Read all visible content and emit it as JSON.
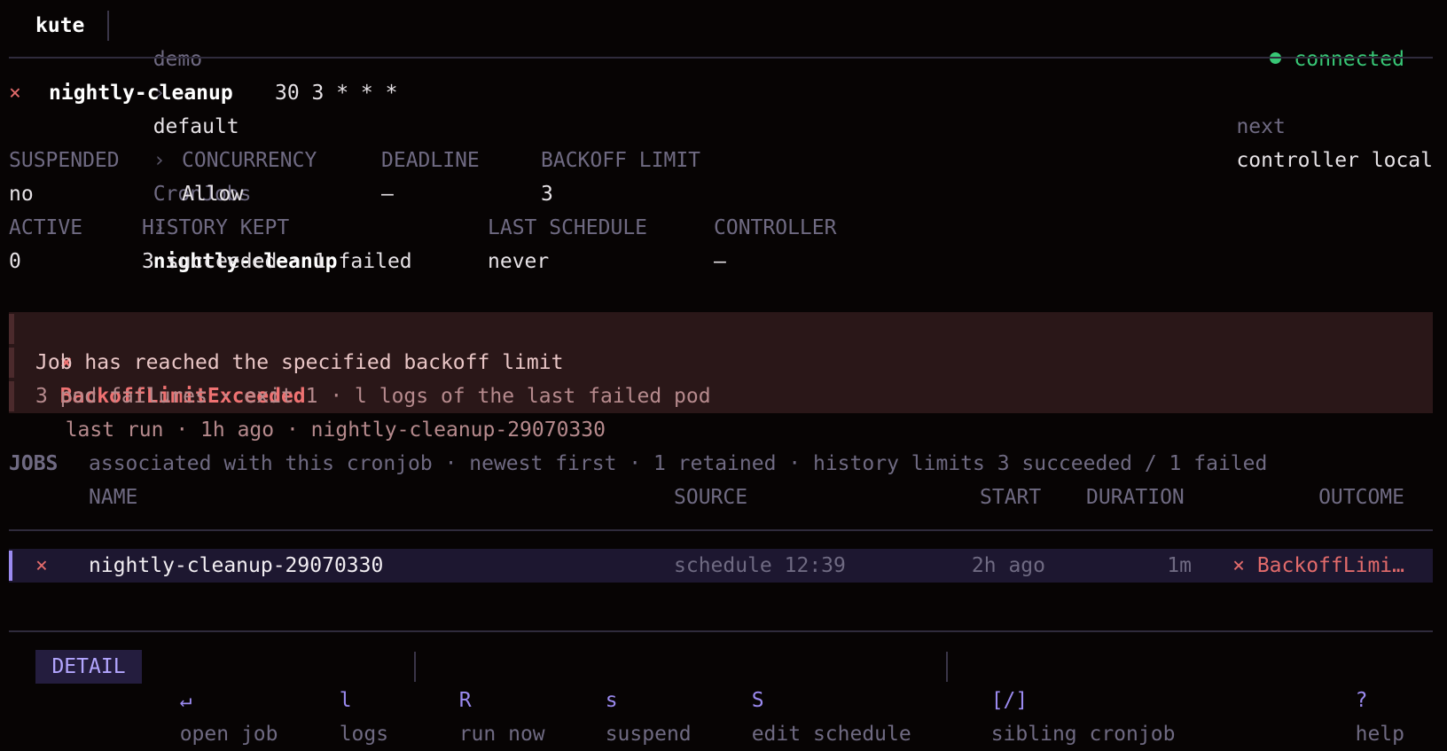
{
  "header": {
    "app": "kute",
    "crumbs": [
      "demo",
      "default",
      "CronJobs",
      "nightly-cleanup"
    ],
    "crumb_sep": "›",
    "status": "connected",
    "status_color": "#38c776"
  },
  "title": {
    "state_icon": "×",
    "name": "nightly-cleanup",
    "schedule": "30 3 * * *",
    "next_label": "next",
    "next_value": "controller local"
  },
  "props_row1": {
    "labels": [
      "SUSPENDED",
      "CONCURRENCY",
      "DEADLINE",
      "BACKOFF LIMIT"
    ],
    "values": [
      "no",
      "Allow",
      "–",
      "3"
    ]
  },
  "props_row2": {
    "labels": [
      "ACTIVE",
      "HISTORY KEPT",
      "LAST SCHEDULE",
      "CONTROLLER"
    ],
    "values": [
      "0",
      "3 succeeded · 1 failed",
      "never",
      "–"
    ]
  },
  "error": {
    "icon": "×",
    "reason": "BackoffLimitExceeded",
    "meta": "last run · 1h ago · nightly-cleanup-29070330",
    "message": "Job has reached the specified backoff limit",
    "detail": "3 pod failures · exit 1 · l logs of the last failed pod"
  },
  "jobs": {
    "title": "JOBS",
    "subtitle": "associated with this cronjob · newest first · 1 retained · history limits 3 succeeded / 1 failed",
    "columns": {
      "name": "NAME",
      "source": "SOURCE",
      "start": "START",
      "duration": "DURATION",
      "outcome": "OUTCOME"
    },
    "rows": [
      {
        "status_icon": "×",
        "name": "nightly-cleanup-29070330",
        "source": "schedule 12:39",
        "start": "2h ago",
        "duration": "1m",
        "outcome": "× BackoffLimi…"
      }
    ]
  },
  "footer": {
    "mode": "DETAIL",
    "actions": [
      {
        "key": "↵",
        "label": "open job"
      },
      {
        "key": "l",
        "label": "logs"
      },
      {
        "key": "R",
        "label": "run now"
      },
      {
        "key": "s",
        "label": "suspend"
      },
      {
        "key": "S",
        "label": "edit schedule"
      },
      {
        "key": "[/]",
        "label": "sibling cronjob"
      },
      {
        "key": "?",
        "label": "help"
      }
    ]
  }
}
